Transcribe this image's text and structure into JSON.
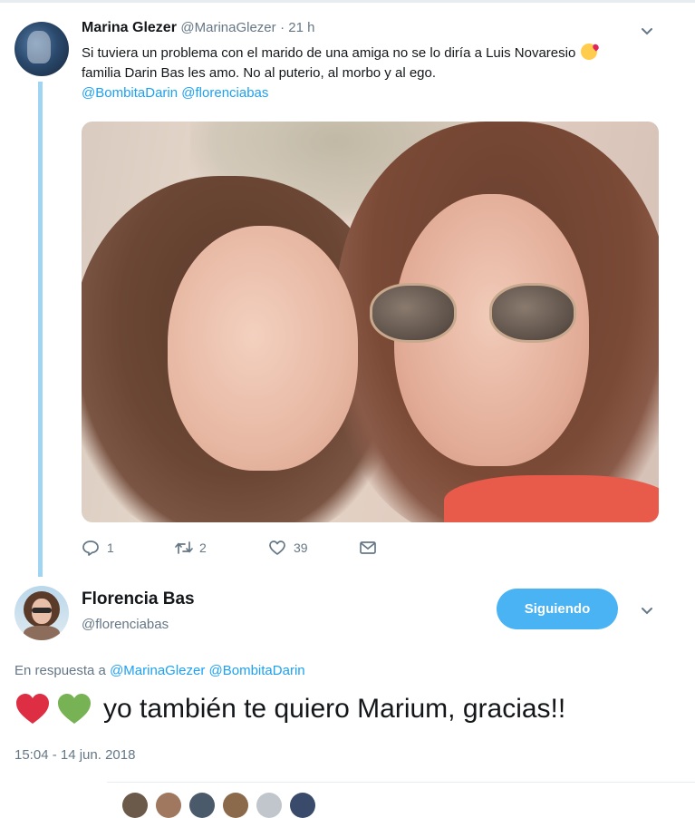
{
  "tweet1": {
    "author_name": "Marina Glezer",
    "author_handle": "@MarinaGlezer",
    "time": "· 21 h",
    "text_part1": "Si tuviera un problema con el marido de una amiga no se lo diría a Luis Novaresio",
    "text_part2": "familia Darin Bas les amo. No al puterio, al morbo y al ego.",
    "mention1": "@BombitaDarin",
    "mention2": "@florenciabas",
    "reply_count": "1",
    "retweet_count": "2",
    "like_count": "39"
  },
  "tweet2": {
    "author_name": "Florencia Bas",
    "author_handle": "@florenciabas",
    "follow_label": "Siguiendo",
    "reply_prefix": "En respuesta a",
    "reply_mention1": "@MarinaGlezer",
    "reply_mention2": "@BombitaDarin",
    "text": "yo también te quiero Marium, gracias!!",
    "timestamp": "15:04 - 14 jun. 2018"
  },
  "colors": {
    "accent": "#1da1f2",
    "follow_button": "#4ab3f4",
    "secondary_text": "#657786",
    "thread_line": "#9fd4f2",
    "heart_red": "#dd2e44",
    "heart_green": "#77b255"
  },
  "icons": {
    "reply": "reply-icon",
    "retweet": "retweet-icon",
    "like": "heart-outline-icon",
    "dm": "envelope-icon",
    "caret": "chevron-down-icon"
  }
}
